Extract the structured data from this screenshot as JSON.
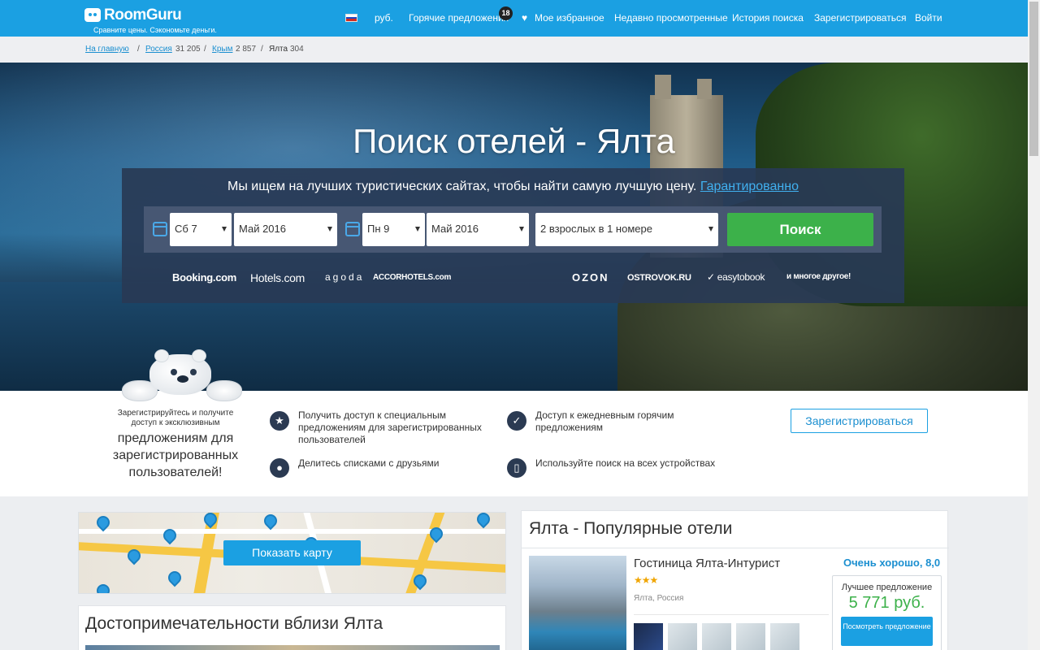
{
  "header": {
    "logo_text": "RoomGuru",
    "tagline": "Сравните цены. Сэкономьте деньги.",
    "currency": "руб.",
    "hot_deals": "Горячие предложения",
    "hot_deals_count": "18",
    "favorites": "Мое избранное",
    "recently_viewed": "Недавно просмотренные",
    "search_history": "История поиска",
    "register": "Зарегистрироваться",
    "login": "Войти"
  },
  "breadcrumb": {
    "home": "На главную",
    "country": "Россия",
    "country_count": "31 205",
    "region": "Крым",
    "region_count": "2 857",
    "city": "Ялта",
    "city_count": "304"
  },
  "hero": {
    "title": "Поиск отелей - Ялта"
  },
  "search": {
    "tagline": "Мы ищем на лучших туристических сайтах, чтобы найти самую лучшую цену.",
    "guarantee_link": "Гарантированно",
    "checkin_day": "Сб 7",
    "checkin_month": "Май 2016",
    "checkout_day": "Пн 9",
    "checkout_month": "Май 2016",
    "guests": "2 взрослых в 1 номере",
    "button": "Поиск"
  },
  "partners": [
    "Booking.com",
    "Hotels.com",
    "agoda",
    "ACCORHOTELS.com",
    "OZON",
    "OSTROVOK.RU",
    "easytobook",
    "и многое другое!"
  ],
  "promo": {
    "small_text": "Зарегистрируйтесь и получите доступ к эксклюзивным",
    "big_text": "предложениям для зарегистрированных пользователей!",
    "features": [
      "Получить доступ к специальным предложениям для зарегистрированных пользователей",
      "Доступ к ежедневным горячим предложениям",
      "Делитесь списками с друзьями",
      "Используйте поиск на всех устройствах"
    ],
    "register_button": "Зарегистрироваться"
  },
  "map": {
    "button": "Показать карту"
  },
  "sights": {
    "title": "Достопримечательности вблизи Ялта"
  },
  "popular": {
    "title": "Ялта - Популярные отели",
    "hotel": {
      "name": "Гостиница Ялта-Интурист",
      "stars": 3,
      "location": "Ялта, Россия",
      "rating": "Очень хорошо, 8,0",
      "offer_label": "Лучшее предложение",
      "price": "5 771 руб.",
      "button": "Посмотреть предложение"
    }
  },
  "colors": {
    "brand": "#1ba0e2",
    "search_button": "#3cb14a",
    "panel": "#283955"
  },
  "icons": [
    "calendar-icon",
    "heart-icon",
    "star-icon",
    "check-icon",
    "people-icon",
    "phone-icon",
    "russia-flag-icon",
    "map-pin-icon"
  ]
}
